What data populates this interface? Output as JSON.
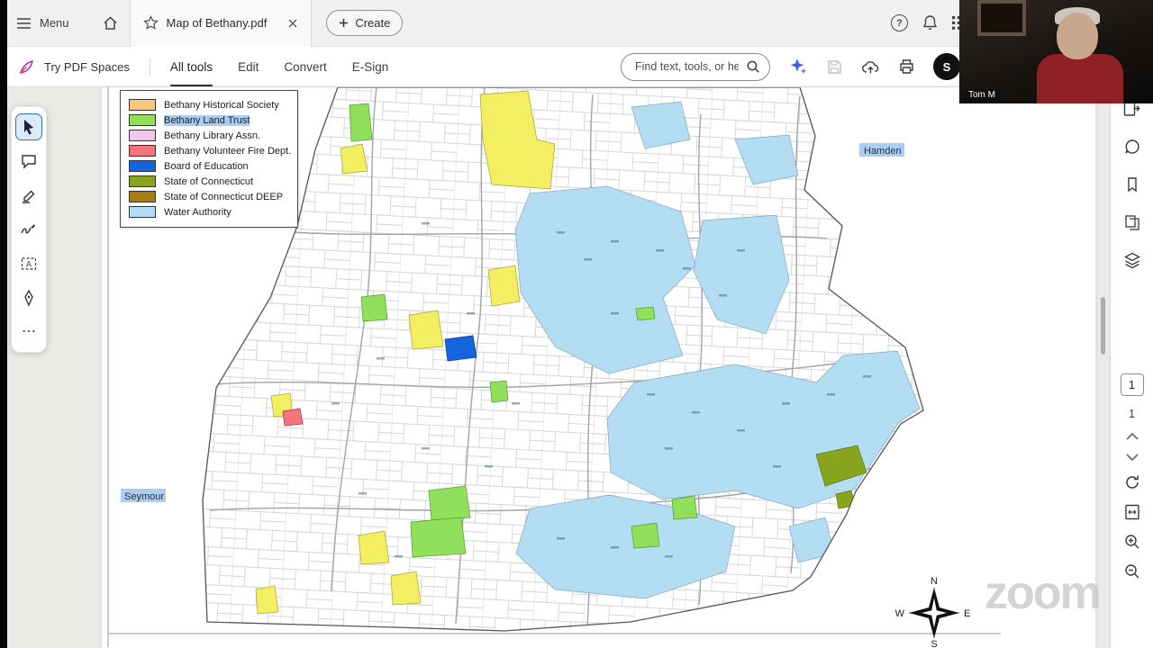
{
  "topbar": {
    "menu_label": "Menu",
    "tab_title": "Map of Bethany.pdf",
    "create_label": "Create"
  },
  "toolbar": {
    "try_pdf_spaces_label": "Try PDF Spaces",
    "tabs": [
      {
        "label": "All tools",
        "active": true
      },
      {
        "label": "Edit",
        "active": false
      },
      {
        "label": "Convert",
        "active": false
      },
      {
        "label": "E-Sign",
        "active": false
      }
    ],
    "search_placeholder": "Find text, tools, or help",
    "account_initial": "S",
    "icons": [
      "ai-assistant",
      "save-disabled",
      "cloud-upload",
      "print"
    ]
  },
  "webcam": {
    "name_tag": "Tom M"
  },
  "left_toolbar": {
    "icons": [
      "select-cursor",
      "add-comment",
      "highlight",
      "draw-signature",
      "add-text",
      "fill-and-sign",
      "more-tools"
    ]
  },
  "right_panel": {
    "icons": [
      "export-pdf",
      "comments",
      "bookmarks",
      "page-thumbnails",
      "layers"
    ],
    "page_current": "1",
    "page_total": "1",
    "nav_icons": [
      "previous-page",
      "next-page",
      "rotate",
      "fit-page",
      "zoom-in",
      "zoom-out"
    ]
  },
  "document": {
    "legend": {
      "items": [
        {
          "label": "Bethany Historical Society",
          "color": "#f7c97d"
        },
        {
          "label": "Bethany Land Trust",
          "color": "#90e05c",
          "highlighted": true
        },
        {
          "label": "Bethany Library Assn.",
          "color": "#f2c7ee"
        },
        {
          "label": "Bethany Volunteer Fire Dept.",
          "color": "#f4747c"
        },
        {
          "label": "Board of Education",
          "color": "#1464e0"
        },
        {
          "label": "State of Connecticut",
          "color": "#8aa41d"
        },
        {
          "label": "State of Connecticut DEEP",
          "color": "#a87c10"
        },
        {
          "label": "Water Authority",
          "color": "#b3ddf2"
        }
      ]
    },
    "map_labels": {
      "hamden": "Hamden",
      "seymour": "Seymour"
    },
    "compass": {
      "n": "N",
      "s": "S",
      "e": "E",
      "w": "W"
    }
  },
  "watermark": "zoom"
}
